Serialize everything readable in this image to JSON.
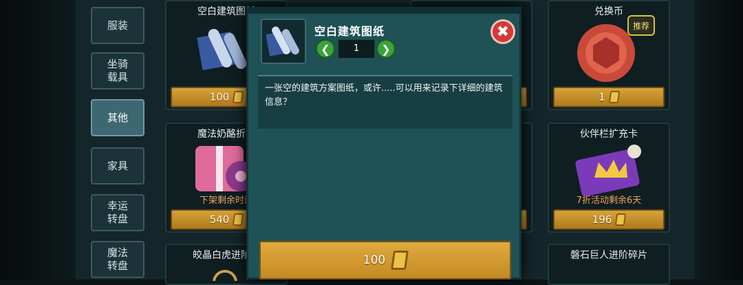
{
  "sidebar": {
    "tabs": [
      {
        "label": "服装"
      },
      {
        "label": "坐骑\n载具"
      },
      {
        "label": "其他",
        "active": true
      },
      {
        "label": "家具"
      },
      {
        "label": "幸运\n转盘"
      },
      {
        "label": "魔法\n转盘"
      }
    ]
  },
  "shop": {
    "items": [
      {
        "title": "空白建筑图纸",
        "price": "100"
      },
      {
        "title": "兑换币",
        "price": "1",
        "badge": "推荐"
      },
      {
        "title": "魔法奶酪折扣",
        "price": "540",
        "promo": "下架剩余时间"
      },
      {
        "title": "伙伴栏扩充卡",
        "price": "196",
        "promo": "7折活动剩余6天"
      },
      {
        "title": "皎晶白虎进阶大"
      },
      {
        "title": "磐石巨人进阶碎片"
      }
    ]
  },
  "modal": {
    "item_name": "空白建筑图纸",
    "quantity": "1",
    "description": "一张空的建筑方案图纸，或许.....可以用来记录下详细的建筑信息？",
    "buy_price": "100",
    "icon": "blueprint-scroll-icon"
  },
  "colors": {
    "accent_gold": "#d6a23a",
    "modal_teal": "#1f5256",
    "close_red": "#d23a3a",
    "arrow_green": "#3aa33c"
  }
}
